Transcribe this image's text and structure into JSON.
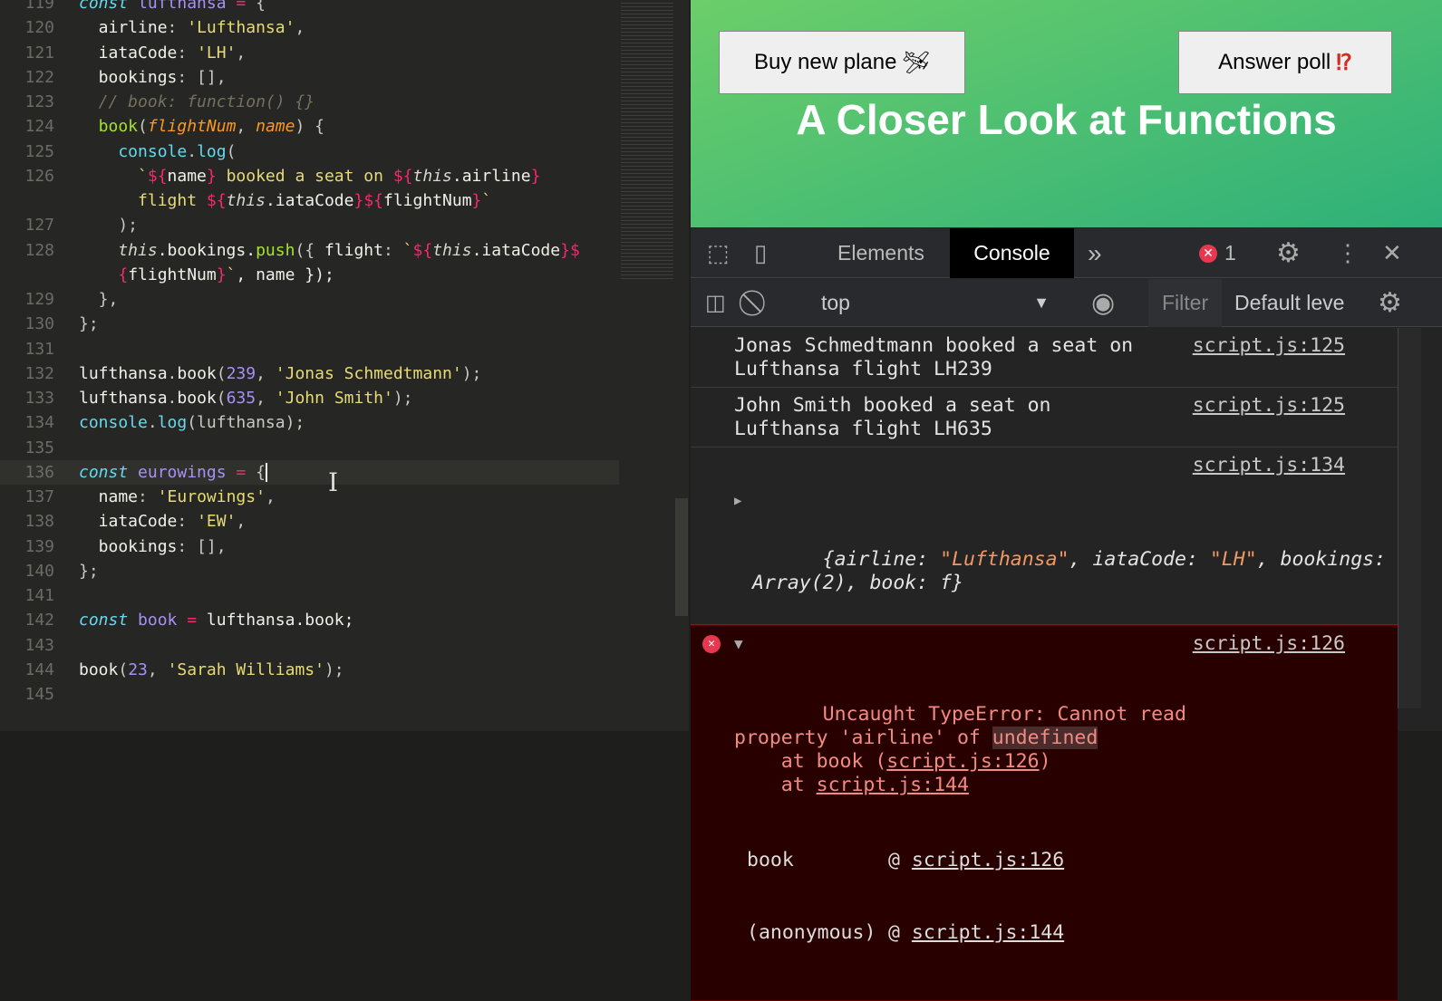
{
  "editor": {
    "lines": [
      {
        "n": "119",
        "t": [
          [
            "const",
            "kw"
          ],
          [
            " ",
            "p"
          ],
          [
            "lufthansa",
            "var"
          ],
          [
            " = ",
            "op"
          ],
          [
            "{",
            "p"
          ]
        ]
      },
      {
        "n": "120",
        "t": [
          [
            "  airline",
            "pr"
          ],
          [
            ": ",
            "p"
          ],
          [
            "'Lufthansa'",
            "s"
          ],
          [
            ",",
            "p"
          ]
        ]
      },
      {
        "n": "121",
        "t": [
          [
            "  iataCode",
            "pr"
          ],
          [
            ": ",
            "p"
          ],
          [
            "'LH'",
            "s"
          ],
          [
            ",",
            "p"
          ]
        ]
      },
      {
        "n": "122",
        "t": [
          [
            "  bookings",
            "pr"
          ],
          [
            ": [],",
            "p"
          ]
        ]
      },
      {
        "n": "123",
        "t": [
          [
            "  // book: function() {}",
            "c"
          ]
        ]
      },
      {
        "n": "124",
        "t": [
          [
            "  book",
            "fn"
          ],
          [
            "(",
            "p"
          ],
          [
            "flightNum",
            "pa"
          ],
          [
            ", ",
            "p"
          ],
          [
            "name",
            "pa"
          ],
          [
            ") {",
            "p"
          ]
        ]
      },
      {
        "n": "125",
        "t": [
          [
            "    console",
            "cf"
          ],
          [
            ".",
            "p"
          ],
          [
            "log",
            "cf"
          ],
          [
            "(",
            "p"
          ]
        ]
      },
      {
        "n": "126",
        "t": [
          [
            "      `",
            "s"
          ],
          [
            "${",
            "tp"
          ],
          [
            "name",
            "pr"
          ],
          [
            "}",
            "tp"
          ],
          [
            " booked a seat on ",
            "s"
          ],
          [
            "${",
            "tp"
          ],
          [
            "this",
            "th"
          ],
          [
            ".airline",
            "pr"
          ],
          [
            "}",
            "tp"
          ]
        ]
      },
      {
        "n": "",
        "t": [
          [
            "      flight ",
            "s"
          ],
          [
            "${",
            "tp"
          ],
          [
            "this",
            "th"
          ],
          [
            ".iataCode",
            "pr"
          ],
          [
            "}${",
            "tp"
          ],
          [
            "flightNum",
            "pr"
          ],
          [
            "}",
            "tp"
          ],
          [
            "`",
            "s"
          ]
        ]
      },
      {
        "n": "127",
        "t": [
          [
            "    );",
            "p"
          ]
        ]
      },
      {
        "n": "128",
        "t": [
          [
            "    this",
            "th"
          ],
          [
            ".bookings.",
            "pr"
          ],
          [
            "push",
            "fn"
          ],
          [
            "({ ",
            "p"
          ],
          [
            "flight",
            "pr"
          ],
          [
            ": ",
            "p"
          ],
          [
            "`",
            "s"
          ],
          [
            "${",
            "tp"
          ],
          [
            "this",
            "th"
          ],
          [
            ".iataCode",
            "pr"
          ],
          [
            "}$",
            "tp"
          ]
        ]
      },
      {
        "n": "",
        "t": [
          [
            "    {",
            "tp"
          ],
          [
            "flightNum",
            "pr"
          ],
          [
            "}",
            "tp"
          ],
          [
            "`",
            "s"
          ],
          [
            ", name });",
            "pr"
          ]
        ]
      },
      {
        "n": "129",
        "t": [
          [
            "  },",
            "p"
          ]
        ]
      },
      {
        "n": "130",
        "t": [
          [
            "};",
            "p"
          ]
        ]
      },
      {
        "n": "131",
        "t": []
      },
      {
        "n": "132",
        "t": [
          [
            "lufthansa",
            "pr"
          ],
          [
            ".",
            "p"
          ],
          [
            "book",
            "pr"
          ],
          [
            "(",
            "p"
          ],
          [
            "239",
            "var"
          ],
          [
            ", ",
            "p"
          ],
          [
            "'Jonas Schmedtmann'",
            "s"
          ],
          [
            ");",
            "p"
          ]
        ]
      },
      {
        "n": "133",
        "t": [
          [
            "lufthansa",
            "pr"
          ],
          [
            ".",
            "p"
          ],
          [
            "book",
            "pr"
          ],
          [
            "(",
            "p"
          ],
          [
            "635",
            "var"
          ],
          [
            ", ",
            "p"
          ],
          [
            "'John Smith'",
            "s"
          ],
          [
            ");",
            "p"
          ]
        ]
      },
      {
        "n": "134",
        "t": [
          [
            "console",
            "cf"
          ],
          [
            ".",
            "p"
          ],
          [
            "log",
            "cf"
          ],
          [
            "(lufthansa);",
            "p"
          ]
        ]
      },
      {
        "n": "135",
        "t": []
      },
      {
        "n": "136",
        "t": [
          [
            "const",
            "kw"
          ],
          [
            " ",
            "p"
          ],
          [
            "eurowings",
            "var"
          ],
          [
            " = ",
            "op"
          ],
          [
            "{",
            "p"
          ]
        ],
        "hl": true
      },
      {
        "n": "137",
        "t": [
          [
            "  name",
            "pr"
          ],
          [
            ": ",
            "p"
          ],
          [
            "'Eurowings'",
            "s"
          ],
          [
            ",",
            "p"
          ]
        ]
      },
      {
        "n": "138",
        "t": [
          [
            "  iataCode",
            "pr"
          ],
          [
            ": ",
            "p"
          ],
          [
            "'EW'",
            "s"
          ],
          [
            ",",
            "p"
          ]
        ]
      },
      {
        "n": "139",
        "t": [
          [
            "  bookings",
            "pr"
          ],
          [
            ": [],",
            "p"
          ]
        ]
      },
      {
        "n": "140",
        "t": [
          [
            "};",
            "p"
          ]
        ]
      },
      {
        "n": "141",
        "t": []
      },
      {
        "n": "142",
        "t": [
          [
            "const",
            "kw"
          ],
          [
            " ",
            "p"
          ],
          [
            "book",
            "var"
          ],
          [
            " = ",
            "op"
          ],
          [
            "lufthansa.book;",
            "pr"
          ]
        ]
      },
      {
        "n": "143",
        "t": []
      },
      {
        "n": "144",
        "t": [
          [
            "book",
            "pr"
          ],
          [
            "(",
            "p"
          ],
          [
            "23",
            "var"
          ],
          [
            ", ",
            "p"
          ],
          [
            "'Sarah Williams'",
            "s"
          ],
          [
            ");",
            "p"
          ]
        ]
      },
      {
        "n": "145",
        "t": []
      }
    ]
  },
  "page": {
    "buy_button": "Buy new plane",
    "buy_emoji": "🛩",
    "poll_button": "Answer poll",
    "poll_emoji": "⁉",
    "heading": "A Closer Look at Functions"
  },
  "devtools": {
    "tabs": {
      "elements": "Elements",
      "console": "Console",
      "more": "»"
    },
    "error_count": "1",
    "context": "top",
    "filter_placeholder": "Filter",
    "levels": "Default leve"
  },
  "console": {
    "m1": {
      "text": "Jonas Schmedtmann booked a seat on\nLufthansa flight LH239",
      "link": "script.js:125"
    },
    "m2": {
      "text": "John Smith booked a seat on\nLufthansa flight LH635",
      "link": "script.js:125"
    },
    "m3": {
      "link": "script.js:134",
      "k1": "airline: ",
      "v1": "\"Lufthansa\"",
      "k2": ", iataCode: ",
      "v2": "\"LH\"",
      "k3": ", bookings:",
      "l2": "Array(2), book: f}"
    },
    "error": {
      "line1": "Uncaught TypeError: Cannot read",
      "line2a": "property 'airline' of ",
      "line2b": "undefined",
      "at1": "at book (",
      "at1link": "script.js:126",
      "at1end": ")",
      "at2": "at ",
      "at2link": "script.js:144",
      "link": "script.js:126",
      "stack": [
        {
          "fn": "book",
          "link": "script.js:126"
        },
        {
          "fn": "(anonymous)",
          "link": "script.js:144"
        }
      ]
    }
  }
}
